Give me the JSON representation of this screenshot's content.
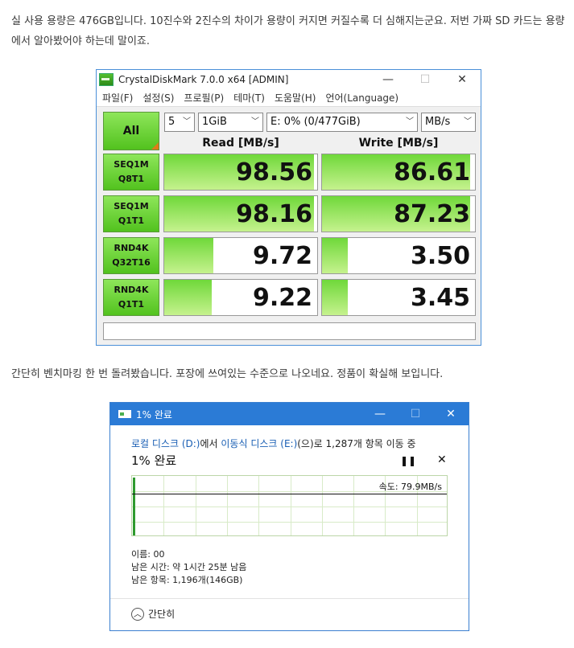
{
  "intro_text": "실 사용 용량은 476GB입니다. 10진수와 2진수의 차이가 용량이 커지면 커질수록 더 심해지는군요. 저번 가짜 SD 카드는 용량에서 알아봤어야 하는데 말이죠.",
  "cdm": {
    "title": "CrystalDiskMark 7.0.0 x64 [ADMIN]",
    "menu": [
      "파일(F)",
      "설정(S)",
      "프로필(P)",
      "테마(T)",
      "도움말(H)",
      "언어(Language)"
    ],
    "all_label": "All",
    "count": "5",
    "size": "1GiB",
    "drive": "E: 0% (0/477GiB)",
    "unit": "MB/s",
    "read_header": "Read [MB/s]",
    "write_header": "Write [MB/s]",
    "rows": [
      {
        "l1": "SEQ1M",
        "l2": "Q8T1",
        "read": "98.56",
        "write": "86.61",
        "read_fill": 0.98,
        "write_fill": 0.97
      },
      {
        "l1": "SEQ1M",
        "l2": "Q1T1",
        "read": "98.16",
        "write": "87.23",
        "read_fill": 0.98,
        "write_fill": 0.97
      },
      {
        "l1": "RND4K",
        "l2": "Q32T16",
        "read": "9.72",
        "write": "3.50",
        "read_fill": 0.32,
        "write_fill": 0.17
      },
      {
        "l1": "RND4K",
        "l2": "Q1T1",
        "read": "9.22",
        "write": "3.45",
        "read_fill": 0.31,
        "write_fill": 0.17
      }
    ]
  },
  "middle_text": "간단히 벤치마킹 한 번 돌려봤습니다. 포장에 쓰여있는 수준으로 나오네요. 정품이 확실해 보입니다.",
  "copy": {
    "title": "1% 완료",
    "from_src": "로컬 디스크 (D:)",
    "from_mid": "에서 ",
    "from_dst": "이동식 디스크 (E:)",
    "from_end": "(으)로 1,287개 항목 이동 중",
    "percent": "1% 완료",
    "speed": "속도: 79.9MB/s",
    "name_line": "이름: 00",
    "time_line": "남은 시간: 약 1시간 25분 남음",
    "items_line": "남은 항목: 1,196개(146GB)",
    "collapse_label": "간단히",
    "progress": 0.01
  }
}
